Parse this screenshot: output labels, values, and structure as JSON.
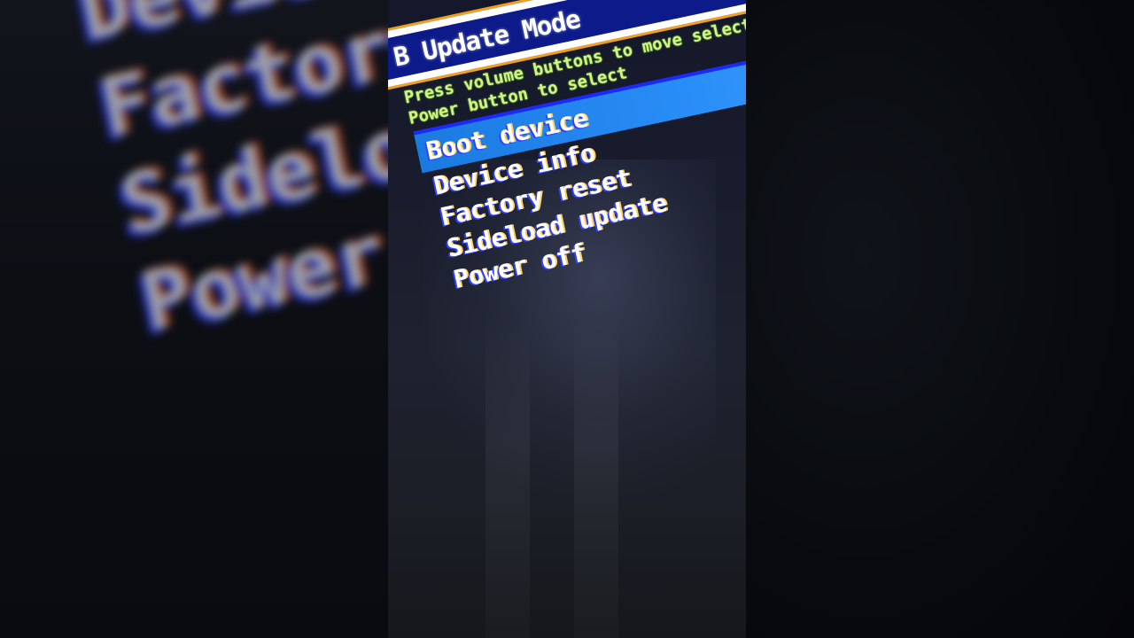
{
  "background": {
    "left_items": [
      "Device info",
      "Factory reset",
      "Sideload update",
      "Power off"
    ]
  },
  "screen": {
    "title": "B Update Mode",
    "instructions": [
      "Press volume buttons to move selection,",
      "Power button to select"
    ],
    "menu": [
      {
        "label": "Boot device",
        "selected": true
      },
      {
        "label": "Device info",
        "selected": false
      },
      {
        "label": "Factory reset",
        "selected": false
      },
      {
        "label": "Sideload update",
        "selected": false
      },
      {
        "label": "Power off",
        "selected": false
      }
    ]
  },
  "colors": {
    "title_bar": "#0d1a8a",
    "title_border": "#ffffff",
    "instructions_text": "#d8f080",
    "highlight": "#2a8ef8",
    "menu_text": "#ffffff"
  }
}
